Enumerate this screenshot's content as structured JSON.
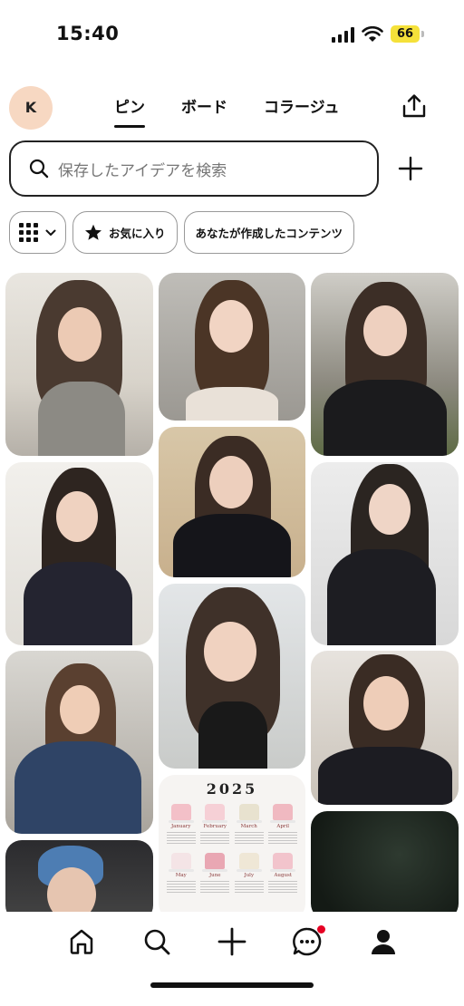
{
  "status_bar": {
    "time": "15:40",
    "battery": "66"
  },
  "header": {
    "avatar_initial": "K",
    "tabs": [
      {
        "label": "ピン",
        "active": true
      },
      {
        "label": "ボード",
        "active": false
      },
      {
        "label": "コラージュ",
        "active": false
      }
    ],
    "share_icon": "share-icon"
  },
  "search": {
    "placeholder": "保存したアイデアを検索",
    "add_icon": "plus-icon"
  },
  "filters": {
    "layout_icon": "grid-icon",
    "favorites_label": "お気に入り",
    "created_label": "あなたが作成したコンテンツ"
  },
  "calendar_pin": {
    "year": "2025",
    "months": [
      "January",
      "February",
      "March",
      "April",
      "May",
      "June",
      "July",
      "August"
    ]
  },
  "bottom_nav": {
    "items": [
      "home-icon",
      "search-icon",
      "create-icon",
      "messages-icon",
      "profile-icon"
    ]
  },
  "colors": {
    "accent": "#e60023",
    "battery": "#f5e13a",
    "avatar_bg": "#f7d8c2"
  }
}
